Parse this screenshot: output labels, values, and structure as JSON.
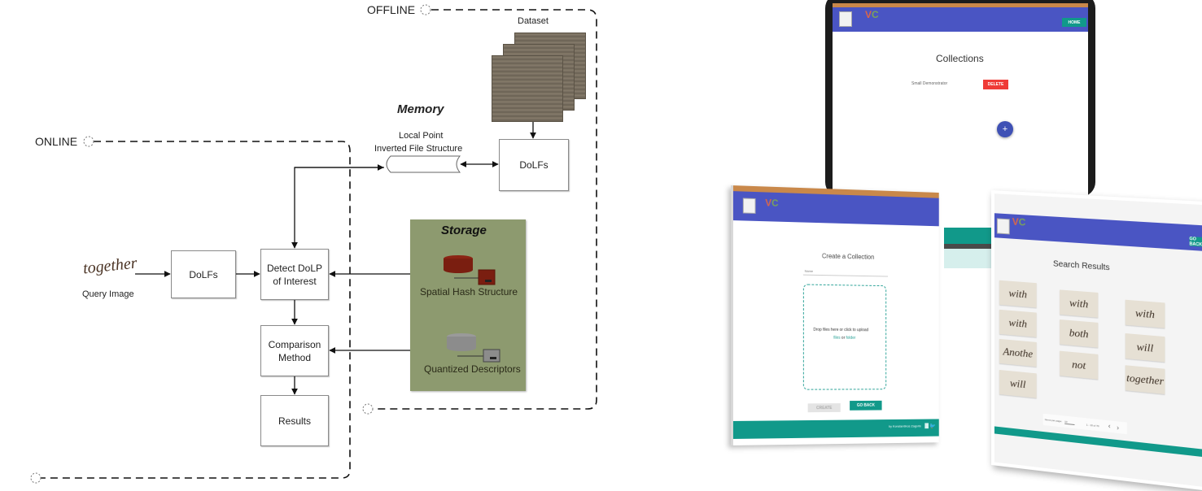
{
  "diagram": {
    "regions": {
      "offline_label": "OFFLINE",
      "online_label": "ONLINE"
    },
    "dataset_label": "Dataset",
    "memory_label": "Memory",
    "inverted_file_label_line1": "Local Point",
    "inverted_file_label_line2": "Inverted File Structure",
    "offline_dolfs_label": "DoLFs",
    "query_image_word": "together",
    "query_image_label": "Query Image",
    "online_dolfs_label": "DoLFs",
    "detect_label_line1": "Detect DoLP",
    "detect_label_line2": "of Interest",
    "comparison_label_line1": "Comparison",
    "comparison_label_line2": "Method",
    "results_label": "Results",
    "storage": {
      "title": "Storage",
      "items": [
        {
          "label": "Spatial Hash Structure",
          "color": "#7a1e10"
        },
        {
          "label": "Quantized Descriptors",
          "color": "#8c8c8c"
        }
      ],
      "background": "#8d9a6f"
    }
  },
  "screens": {
    "app_name_v": "V",
    "app_name_c": "C",
    "collections": {
      "title": "Collections",
      "home_button": "HOME",
      "items": [
        {
          "name": "Small Demonstrator",
          "delete_label": "DELETE"
        }
      ],
      "add_button": "+"
    },
    "create": {
      "title": "Create a Collection",
      "name_placeholder": "Name",
      "drop_text": "Drop files here or click to upload",
      "files_link": "files",
      "or_text": "or",
      "folder_link": "folder",
      "create_button": "CREATE",
      "go_back_button": "GO BACK",
      "footer_text": "by Konstantinos Zagoris"
    },
    "results": {
      "title": "Search Results",
      "go_back_button": "GO BACK",
      "words": [
        "with",
        "with",
        "with",
        "with",
        "both",
        "will",
        "Anothe",
        "not",
        "together",
        "will"
      ],
      "items_per_page_label": "Items per page:",
      "items_per_page_value": "10",
      "range_text": "1 - 10 of 70",
      "prev": "‹",
      "next": "›"
    },
    "colors": {
      "appbar": "#4a55c3",
      "teal": "#11998a",
      "delete_red": "#ef3b36",
      "fab": "#3f51b5"
    }
  }
}
